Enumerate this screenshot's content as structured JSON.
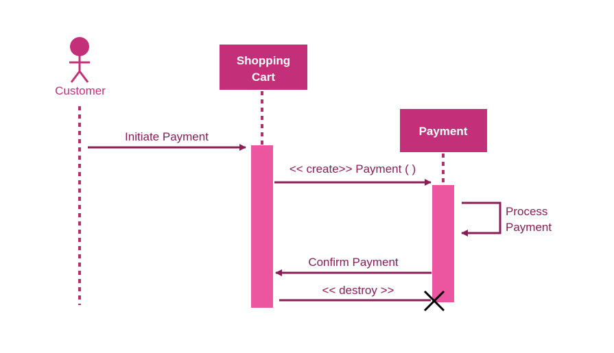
{
  "diagram": {
    "type": "sequence",
    "colors": {
      "participant_fill": "#c42f7a",
      "activation_fill": "#ec559f",
      "message_line": "#8a1c56",
      "lifeline": "#b82d6e",
      "destroy_mark": "#000000"
    },
    "actor": {
      "name": "Customer",
      "icon": "stick-figure-icon"
    },
    "participants": [
      {
        "id": "cart",
        "label_lines": [
          "Shopping",
          "Cart"
        ]
      },
      {
        "id": "payment",
        "label_lines": [
          "Payment"
        ]
      }
    ],
    "messages": [
      {
        "from": "customer",
        "to": "cart",
        "label": "Initiate Payment",
        "direction": "right"
      },
      {
        "from": "cart",
        "to": "payment",
        "label": "<< create>> Payment ( )",
        "direction": "right"
      },
      {
        "from": "payment",
        "to": "payment",
        "label_lines": [
          "Process",
          "Payment"
        ],
        "direction": "self"
      },
      {
        "from": "payment",
        "to": "cart",
        "label": "Confirm Payment",
        "direction": "left"
      },
      {
        "from": "cart",
        "to": "payment",
        "label": "<< destroy >>",
        "direction": "right",
        "destroy": true
      }
    ]
  }
}
